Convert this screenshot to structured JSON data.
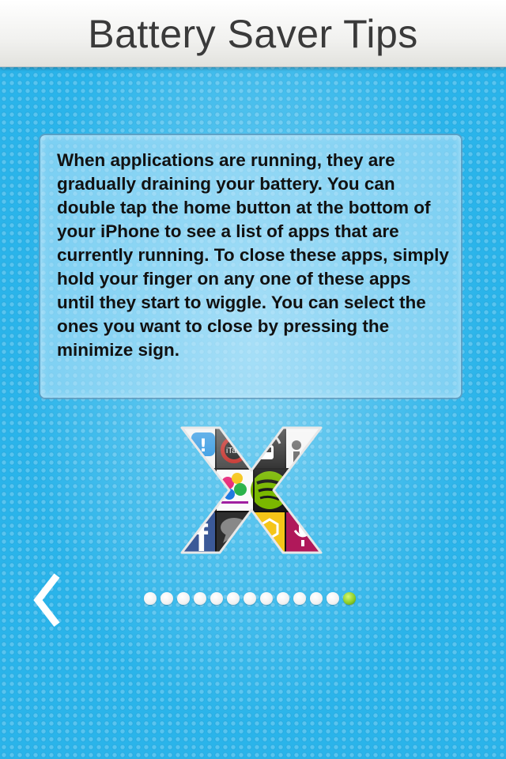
{
  "header": {
    "title": "Battery Saver Tips"
  },
  "tip": {
    "text": "When applications are running, they are gradually draining your battery.  You can double tap the home button at the bottom of your iPhone to see a list of apps that are currently running. To close these apps, simply hold your finger on any one of these apps until they start to wiggle. You can select the ones you want to close by pressing the minimize sign."
  },
  "illustration": {
    "icon": "app-icons-x-icon",
    "app_label": "iTalk"
  },
  "navigation": {
    "back_icon": "chevron-left-icon",
    "page_count": 13,
    "current_page": 13
  },
  "colors": {
    "background": "#2ab4ea",
    "active_dot": "#8ecf2a",
    "inactive_dot": "#ffffff"
  }
}
